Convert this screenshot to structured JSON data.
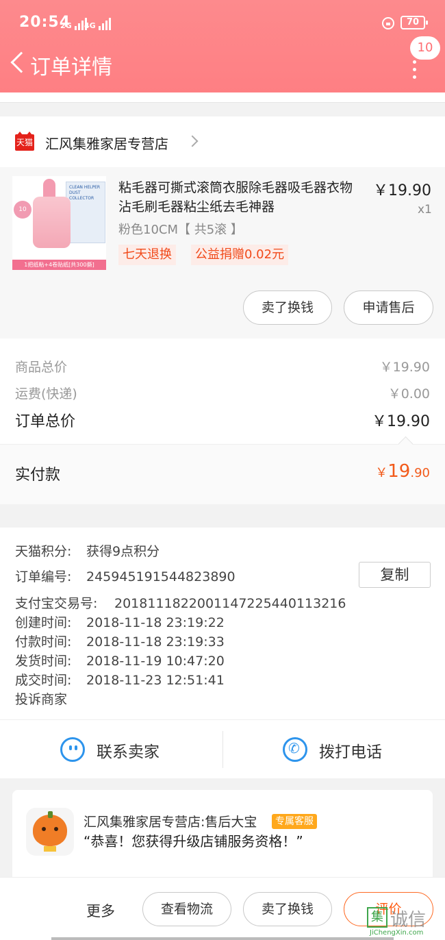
{
  "status_bar": {
    "time": "20:54",
    "signal1": "2G",
    "signal2": "4G",
    "battery": "70"
  },
  "header": {
    "title": "订单详情",
    "message_badge": "10"
  },
  "shop": {
    "badge": "天猫",
    "name": "汇风集雅家居专营店"
  },
  "product": {
    "title": "粘毛器可撕式滚筒衣服除毛器吸毛器衣物沾毛刷毛器粘尘纸去毛神器",
    "price": "￥19.90",
    "qty": "x1",
    "spec": "粉色10CM【 共5滚 】",
    "tags": [
      "七天退换",
      "公益捐赠0.02元"
    ],
    "image_text": {
      "box_text": "CLEAN HELPER DUST COLLECTOR",
      "circle_tag": "10",
      "banner": "1把纸粘+4卷贴纸[共300撕]"
    },
    "buttons": [
      "卖了换钱",
      "申请售后"
    ]
  },
  "summary": {
    "goods_total_label": "商品总价",
    "goods_total_value": "￥19.90",
    "shipping_label": "运费(快递)",
    "shipping_value": "￥0.00",
    "order_total_label": "订单总价",
    "order_total_value": "￥19.90",
    "paid_label": "实付款",
    "paid_currency": "￥",
    "paid_integer": "19",
    "paid_decimal": ".90"
  },
  "order_info": {
    "points_label": "天猫积分:",
    "points_value": "获得9点积分",
    "order_no_label": "订单编号:",
    "order_no_value": "245945191544823890",
    "copy_label": "复制",
    "alipay_label": "支付宝交易号:",
    "alipay_value": "2018111822001147225440113216",
    "created_label": "创建时间:",
    "created_value": "2018-11-18 23:19:22",
    "paid_label": "付款时间:",
    "paid_value": "2018-11-18 23:19:33",
    "shipped_label": "发货时间:",
    "shipped_value": "2018-11-19 10:47:20",
    "completed_label": "成交时间:",
    "completed_value": "2018-11-23 12:51:41",
    "complaint_label": "投诉商家"
  },
  "contact": {
    "seller_label": "联系卖家",
    "phone_label": "拨打电话"
  },
  "chat_card": {
    "name": "汇风集雅家居专营店:售后大宝",
    "tag": "专属客服",
    "message": "“恭喜！您获得升级店铺服务资格！”"
  },
  "bottom_bar": {
    "more_label": "更多",
    "logistics_label": "查看物流",
    "sell_label": "卖了换钱",
    "review_label": "评价"
  },
  "watermark": {
    "mark": "集",
    "text": "诚信",
    "url": "JiChengXin.com"
  },
  "colors": {
    "header": "#fe7f83",
    "accent_orange": "#f25a1a",
    "link_blue": "#2d94ec",
    "tmall_red": "#e4221b"
  }
}
